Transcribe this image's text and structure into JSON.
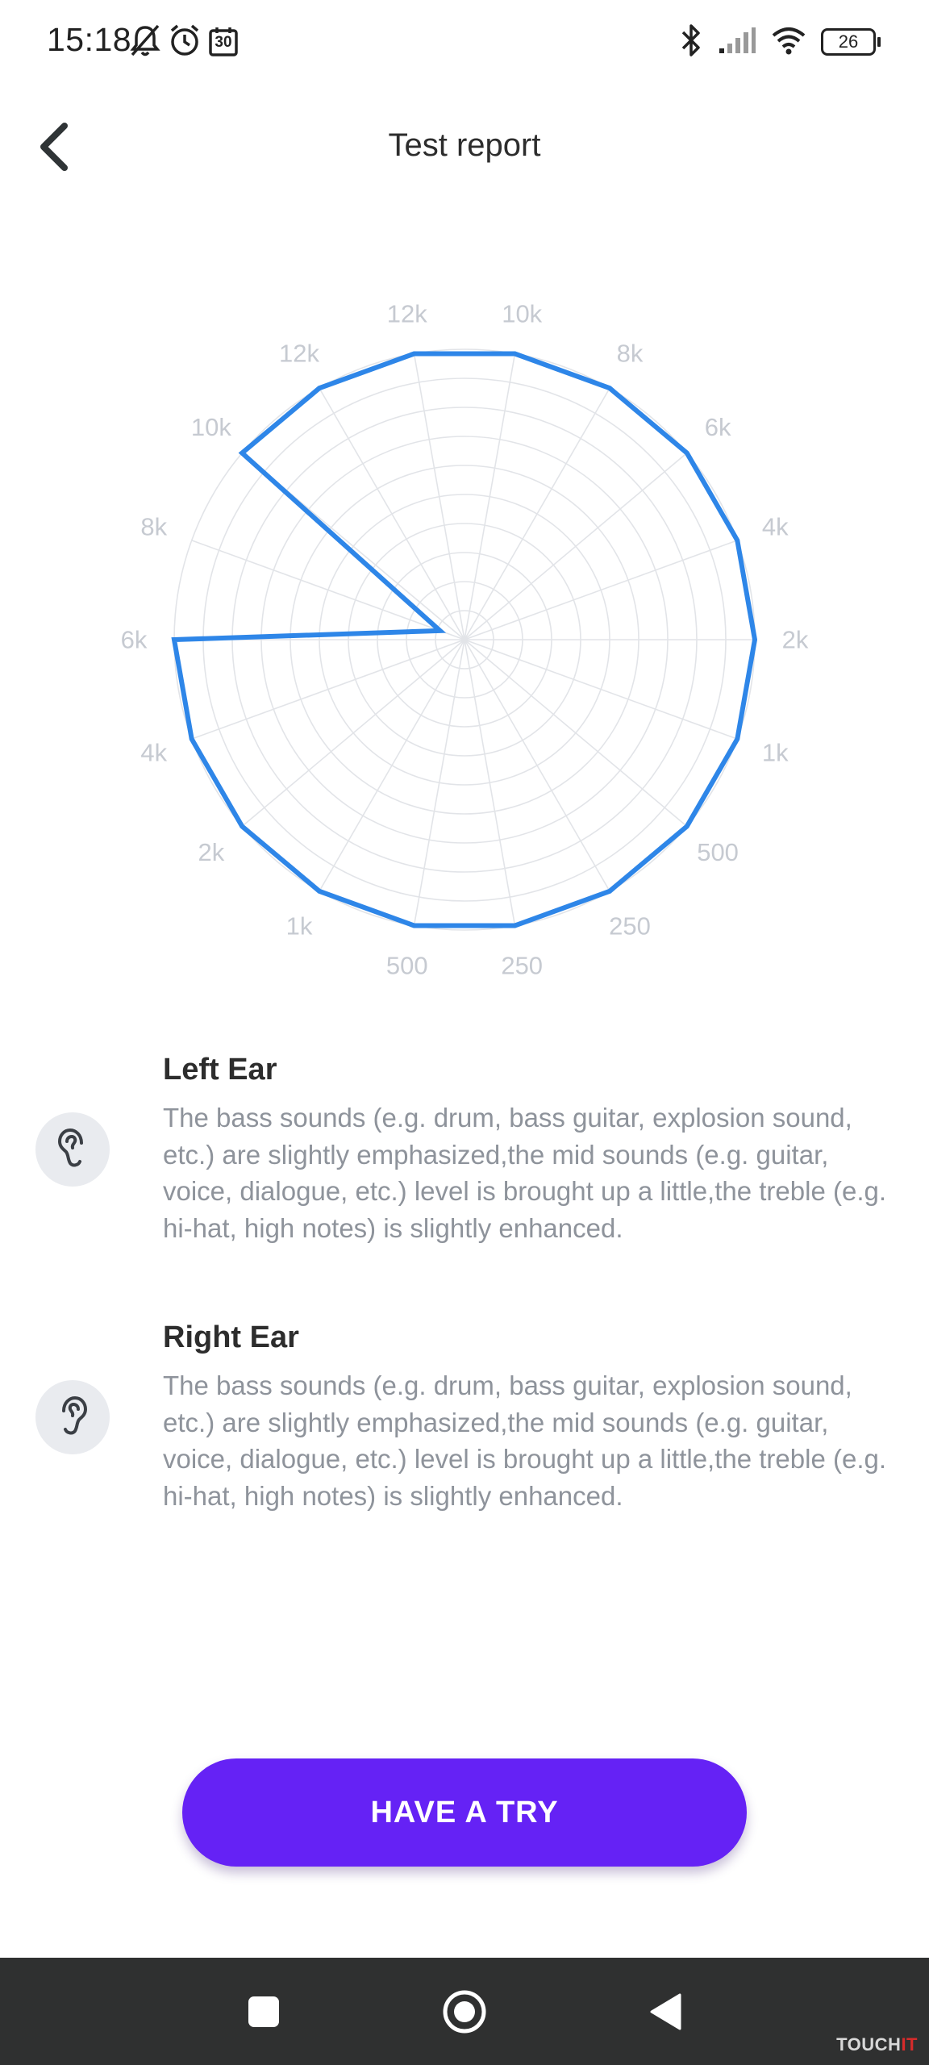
{
  "status_bar": {
    "time": "15:18",
    "calendar_day": "30",
    "battery": "26"
  },
  "header": {
    "title": "Test report"
  },
  "chart_data": {
    "type": "radar",
    "title": "",
    "ring_count": 10,
    "r_max": 10,
    "axes_labels": [
      "12k",
      "10k",
      "8k",
      "6k",
      "4k",
      "2k",
      "1k",
      "500",
      "250",
      "250",
      "500",
      "1k",
      "2k",
      "4k",
      "6k",
      "8k",
      "10k",
      "12k"
    ],
    "series": [
      {
        "color": "#2e86e8",
        "values": [
          10,
          10,
          10,
          10,
          10,
          10,
          10,
          10,
          10,
          10,
          10,
          10,
          10,
          10,
          10,
          0.9,
          10,
          10
        ]
      }
    ]
  },
  "left_ear": {
    "title": "Left Ear",
    "description": "The bass sounds (e.g. drum, bass guitar, explosion sound, etc.) are slightly emphasized,the mid sounds (e.g. guitar, voice, dialogue, etc.) level is brought up a little,the treble (e.g. hi-hat, high notes) is slightly enhanced.",
    "icon": "left-ear-icon"
  },
  "right_ear": {
    "title": "Right Ear",
    "description": "The bass sounds (e.g. drum, bass guitar, explosion sound, etc.) are slightly emphasized,the mid sounds (e.g. guitar, voice, dialogue, etc.) level is brought up a little,the treble (e.g. hi-hat, high notes) is slightly enhanced.",
    "icon": "right-ear-icon"
  },
  "action": {
    "button_label": "HAVE A TRY"
  },
  "watermark": {
    "main": "TOUCH",
    "accent": "IT"
  },
  "colors": {
    "accent": "#6522f5",
    "chart_line": "#2e86e8",
    "nav_bar": "#2f3030"
  }
}
